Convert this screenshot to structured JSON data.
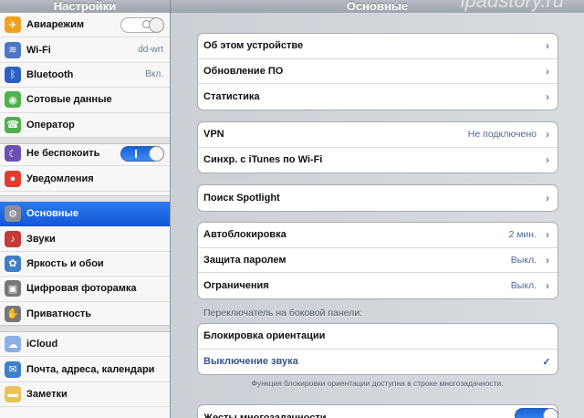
{
  "sidebar": {
    "title": "Настройки",
    "groups": [
      [
        {
          "label": "Авиарежим",
          "icon": "airplane-icon",
          "icon_color": "#f0a020",
          "toggle": "off"
        },
        {
          "label": "Wi-Fi",
          "icon": "wifi-icon",
          "icon_color": "#4a77c8",
          "value": "dd-wrt"
        },
        {
          "label": "Bluetooth",
          "icon": "bluetooth-icon",
          "icon_color": "#2d5fc4",
          "value": "Вкл."
        },
        {
          "label": "Сотовые данные",
          "icon": "cellular-icon",
          "icon_color": "#4fb04c"
        },
        {
          "label": "Оператор",
          "icon": "phone-icon",
          "icon_color": "#4fb04c"
        }
      ],
      [
        {
          "label": "Не беспокоить",
          "icon": "moon-icon",
          "icon_color": "#6a4fb4",
          "toggle": "on"
        },
        {
          "label": "Уведомления",
          "icon": "notifications-icon",
          "icon_color": "#e03c31"
        }
      ],
      [
        {
          "label": "Основные",
          "icon": "gear-icon",
          "icon_color": "#8a8f99",
          "selected": true
        },
        {
          "label": "Звуки",
          "icon": "speaker-icon",
          "icon_color": "#c43a36"
        },
        {
          "label": "Яркость и обои",
          "icon": "flower-icon",
          "icon_color": "#3e7fc7"
        },
        {
          "label": "Цифровая фоторамка",
          "icon": "photo-frame-icon",
          "icon_color": "#777777"
        },
        {
          "label": "Приватность",
          "icon": "hand-icon",
          "icon_color": "#777777"
        }
      ],
      [
        {
          "label": "iCloud",
          "icon": "cloud-icon",
          "icon_color": "#8aaee6"
        },
        {
          "label": "Почта, адреса, календари",
          "icon": "mail-icon",
          "icon_color": "#3e7fc7"
        },
        {
          "label": "Заметки",
          "icon": "notes-icon",
          "icon_color": "#e8c35a"
        }
      ]
    ]
  },
  "main": {
    "title": "Основные",
    "watermark": "ipadstory.ru",
    "groups": [
      {
        "rows": [
          {
            "label": "Об этом устройстве",
            "chevron": true
          },
          {
            "label": "Обновление ПО",
            "chevron": true
          },
          {
            "label": "Статистика",
            "chevron": true
          }
        ]
      },
      {
        "rows": [
          {
            "label": "VPN",
            "value": "Не подключено",
            "chevron": true
          },
          {
            "label": "Синхр. с iTunes по Wi-Fi",
            "chevron": true
          }
        ]
      },
      {
        "rows": [
          {
            "label": "Поиск Spotlight",
            "chevron": true
          }
        ]
      },
      {
        "rows": [
          {
            "label": "Автоблокировка",
            "value": "2 мин.",
            "chevron": true
          },
          {
            "label": "Защита паролем",
            "value": "Выкл.",
            "chevron": true
          },
          {
            "label": "Ограничения",
            "value": "Выкл.",
            "chevron": true
          }
        ]
      },
      {
        "rows": [
          {
            "label": "Блокировка ориентации"
          },
          {
            "label": "Выключение звука",
            "check": true
          }
        ]
      },
      {
        "rows": [
          {
            "label": "Жесты многозадачности"
          }
        ]
      }
    ],
    "section_header": "Переключатель на боковой панели:",
    "footnote": "Функция блокировки ориентации доступна в строке многозадачности.",
    "chevron_glyph": "›",
    "check_glyph": "✓",
    "toggle_label_on": "I"
  }
}
